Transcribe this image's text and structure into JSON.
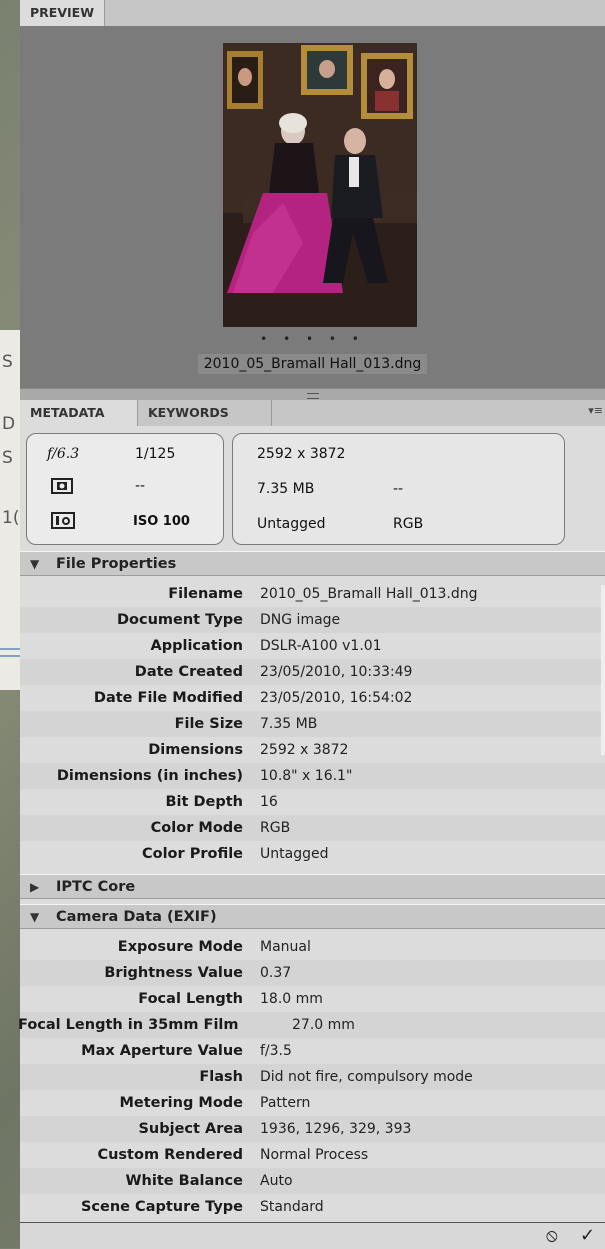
{
  "background_window": {
    "letters": [
      "S",
      "D",
      "S",
      "1("
    ]
  },
  "preview_panel": {
    "tab_label": "PREVIEW",
    "filename": "2010_05_Bramall Hall_013.dng",
    "page_dots": "• • • • •"
  },
  "metadata_panel": {
    "tabs": [
      "METADATA",
      "KEYWORDS"
    ],
    "summary": {
      "aperture": "𝑓/6.3",
      "shutter": "1/125",
      "metering_value": "--",
      "iso": "ISO 100",
      "dimensions": "2592 x 3872",
      "file_size": "7.35 MB",
      "file_size_extra": "--",
      "color_profile": "Untagged",
      "color_mode": "RGB"
    },
    "sections": {
      "file_properties": {
        "title": "File Properties",
        "rows": [
          {
            "key": "Filename",
            "value": "2010_05_Bramall Hall_013.dng"
          },
          {
            "key": "Document Type",
            "value": "DNG image"
          },
          {
            "key": "Application",
            "value": "DSLR-A100 v1.01"
          },
          {
            "key": "Date Created",
            "value": "23/05/2010, 10:33:49"
          },
          {
            "key": "Date File Modified",
            "value": "23/05/2010, 16:54:02"
          },
          {
            "key": "File Size",
            "value": "7.35 MB"
          },
          {
            "key": "Dimensions",
            "value": "2592 x 3872"
          },
          {
            "key": "Dimensions (in inches)",
            "value": "10.8\" x 16.1\""
          },
          {
            "key": "Bit Depth",
            "value": "16"
          },
          {
            "key": "Color Mode",
            "value": "RGB"
          },
          {
            "key": "Color Profile",
            "value": "Untagged"
          }
        ]
      },
      "iptc_core": {
        "title": "IPTC Core"
      },
      "camera_data": {
        "title": "Camera Data (EXIF)",
        "rows": [
          {
            "key": "Exposure Mode",
            "value": "Manual"
          },
          {
            "key": "Brightness Value",
            "value": "0.37"
          },
          {
            "key": "Focal Length",
            "value": "18.0 mm"
          },
          {
            "key": "Focal Length in 35mm Film",
            "value": "27.0 mm"
          },
          {
            "key": "Max Aperture Value",
            "value": "f/3.5"
          },
          {
            "key": "Flash",
            "value": "Did not fire, compulsory mode"
          },
          {
            "key": "Metering Mode",
            "value": "Pattern"
          },
          {
            "key": "Subject Area",
            "value": "1936, 1296, 329, 393"
          },
          {
            "key": "Custom Rendered",
            "value": "Normal Process"
          },
          {
            "key": "White Balance",
            "value": "Auto"
          },
          {
            "key": "Scene Capture Type",
            "value": "Standard"
          }
        ]
      }
    },
    "footer": {
      "cancel_icon": "⦸",
      "apply_icon": "✓"
    }
  }
}
